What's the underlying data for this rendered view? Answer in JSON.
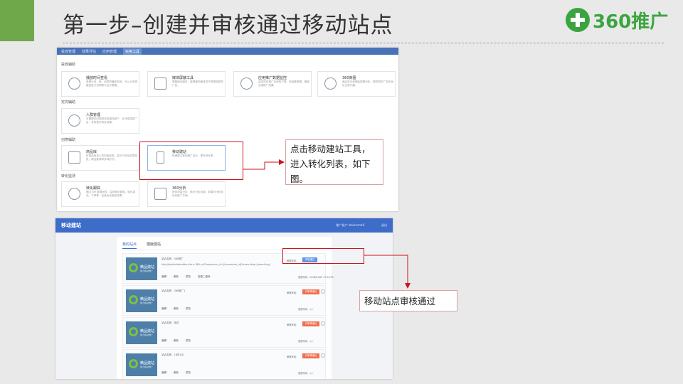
{
  "slide": {
    "title": "第一步–创建并审核通过移动站点",
    "logo": "360推广"
  },
  "shot1": {
    "nav": [
      "投放管理",
      "效果评估",
      "应用管理",
      "实用工具"
    ],
    "sections": [
      "投放辅助",
      "定向辅助",
      "创意辅助",
      "转化监测"
    ],
    "cards": [
      {
        "title": "播放时间查看",
        "desc": "查看计划、组、创意的播放时间，可以从来调整投放计划预算与出价策略。",
        "icon": "clock-icon"
      },
      {
        "title": "媒体屏蔽工具",
        "desc": "屏蔽指定媒体，被屏蔽的媒体将不再展现您的广告。",
        "icon": "block-icon"
      },
      {
        "title": "应用推广数据监控",
        "desc": "监控您在推广应用的下载、安装等数据，确保应用推广效果。",
        "icon": "monitor-icon"
      },
      {
        "title": "360商圈",
        "desc": "通过定位商圈及数据分析，提供您的广告在地址交易兴趣。",
        "icon": "pie-icon"
      },
      {
        "title": "人群管理",
        "desc": "可管理访问您网站的潜在客户，针对性投放广告，有效提升转化效果。",
        "icon": "people-icon"
      },
      {
        "title": "商品库",
        "desc": "将商品信息上传到商品库，支持个性化创意投放，商品推荐等多种形式。",
        "icon": "folder-icon"
      },
      {
        "title": "移动建站",
        "desc": "快速建立移动推广站点，提升转化率。",
        "icon": "phone-icon"
      },
      {
        "title": "转化跟踪",
        "desc": "通过 API 数据回传，监测转化数据，转化激活、下单等，后续优化投放效果。",
        "icon": "target-icon"
      },
      {
        "title": "360分析",
        "desc": "提供流量分析、转化分析功能，效果可比较及优化推广方案。",
        "icon": "chart-icon"
      }
    ]
  },
  "shot2": {
    "title": "移动建站",
    "account": "推广账户: baimcmh8",
    "logout": "退出",
    "tabs": [
      "我的站点",
      "模版建站"
    ],
    "thumb_text": "精品建站",
    "thumb_sub": "助力移动推广",
    "rows": [
      {
        "name": "站点名称：360推广",
        "url": "http://baidusitebuilder.site.e.360.cn/?impression_id=[impression_id]&searchtag=[searchtag]",
        "status_label": "审核状态：",
        "status": "审核通过",
        "status_kind": "ok",
        "time": "发布时间：2018/01/04 17:16:34",
        "actions": [
          "编辑",
          "删除",
          "预览",
          "查看二维码"
        ]
      },
      {
        "name": "站点名称：360推广1",
        "url": "",
        "status_label": "审核状态：",
        "status": "待审核通过",
        "status_kind": "fail",
        "time": "发布时间：-/-/-",
        "actions": [
          "编辑",
          "删除",
          "预览"
        ]
      },
      {
        "name": "站点名称：测试",
        "url": "",
        "status_label": "审核状态：",
        "status": "待审核通过",
        "status_kind": "fail",
        "time": "发布时间：-/-/-",
        "actions": [
          "编辑",
          "删除",
          "预览"
        ]
      },
      {
        "name": "站点名称：18年1月",
        "url": "",
        "status_label": "审核状态：",
        "status": "待审核通过",
        "status_kind": "fail",
        "time": "发布时间：-/-/-",
        "actions": [
          "编辑",
          "删除",
          "预览"
        ]
      }
    ]
  },
  "callouts": {
    "first": "点击移动建站工具，进入转化列表，如下图。",
    "second": "移动站点审核通过"
  }
}
